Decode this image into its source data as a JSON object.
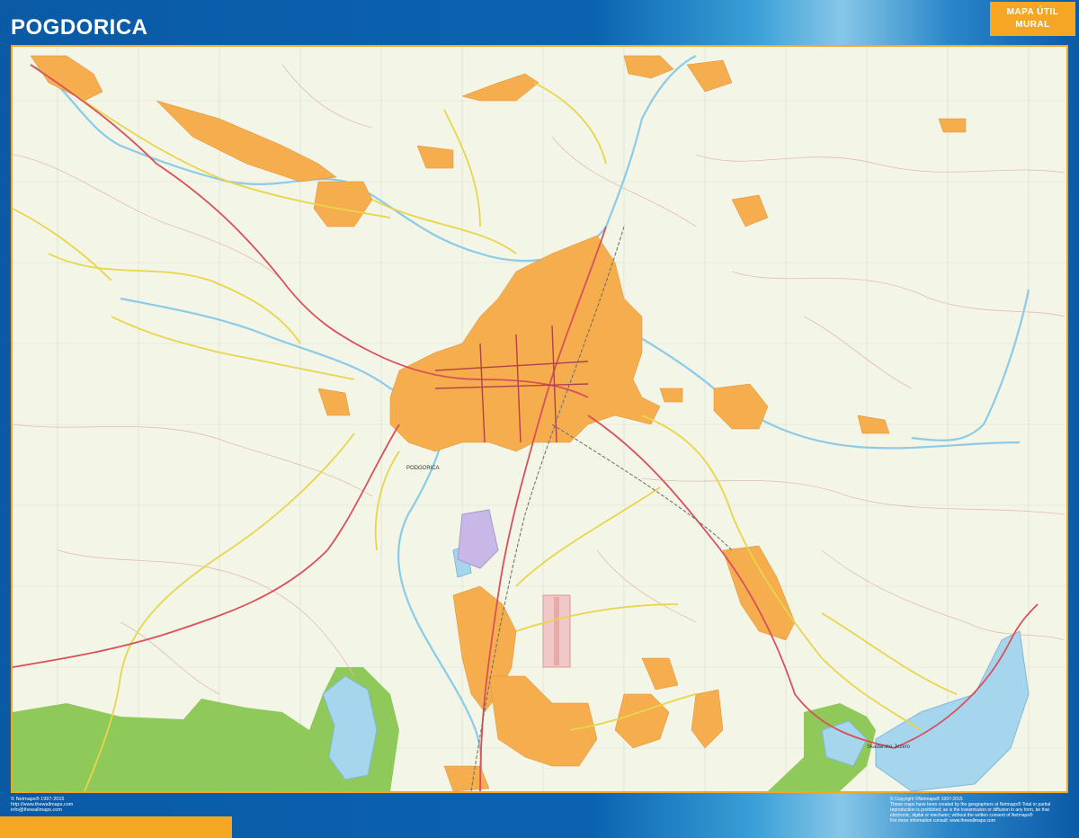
{
  "header": {
    "title": "POGDORICA",
    "badge_line1": "MAPA ÚTIL",
    "badge_line2": "MURAL"
  },
  "map": {
    "labels": {
      "city": "PODGORICA",
      "lake_name": "Skadarsko Jezero"
    },
    "colors": {
      "land": "#f3f5e6",
      "urban": "#f5ad4e",
      "water": "#a6d6ee",
      "park": "#8fc95a",
      "major_road": "#d8505a",
      "secondary_road": "#e8d84a",
      "minor_road": "#e0b8b0",
      "grid": "#cfd8d2"
    }
  },
  "footer": {
    "left_lines": [
      "© Netmaps® 1997-2015",
      "http://www.thewallmaps.com",
      "info@thewallmaps.com"
    ],
    "right_lines": [
      "© Copyright ©Netmaps® 1997-2015",
      "These maps have been created by the geographers at Netmaps® Total or partial",
      "reproduction is prohibited; as is the transmission or diffusion in any form, be that",
      "electronic, digital or mechanic; without the written consent of Netmaps®",
      "For more information consult: www.thewallmaps.com"
    ]
  }
}
